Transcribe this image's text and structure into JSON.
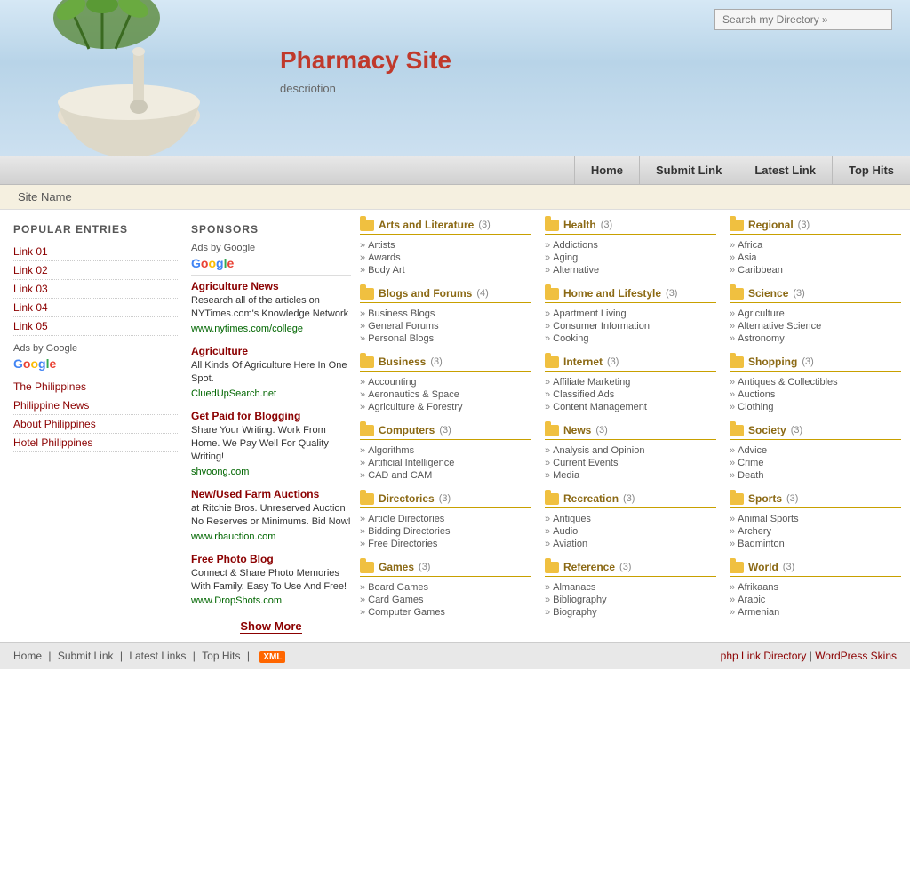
{
  "header": {
    "search_placeholder": "Search my Directory »",
    "site_title": "Pharmacy Site",
    "site_desc": "descriotion"
  },
  "navbar": {
    "items": [
      {
        "label": "Home",
        "href": "#"
      },
      {
        "label": "Submit Link",
        "href": "#"
      },
      {
        "label": "Latest Link",
        "href": "#"
      },
      {
        "label": "Top Hits",
        "href": "#"
      }
    ]
  },
  "sitename": "Site Name",
  "sidebar": {
    "popular_title": "POPULAR ENTRIES",
    "popular_links": [
      {
        "label": "Link 01",
        "href": "#"
      },
      {
        "label": "Link 02",
        "href": "#"
      },
      {
        "label": "Link 03",
        "href": "#"
      },
      {
        "label": "Link 04",
        "href": "#"
      },
      {
        "label": "Link 05",
        "href": "#"
      }
    ],
    "ads_label": "Ads by Google",
    "geo_links": [
      {
        "label": "The Philippines",
        "href": "#"
      },
      {
        "label": "Philippine News",
        "href": "#"
      },
      {
        "label": "About Philippines",
        "href": "#"
      },
      {
        "label": "Hotel Philippines",
        "href": "#"
      }
    ]
  },
  "sponsors": {
    "title": "SPONSORS",
    "ads_label": "Ads by Google",
    "show_more": "Show More",
    "items": [
      {
        "title": "Agriculture News",
        "desc": "Research all of the articles on NYTimes.com's Knowledge Network",
        "url": "www.nytimes.com/college"
      },
      {
        "title": "Agriculture",
        "desc": "All Kinds Of Agriculture Here In One Spot.",
        "url": "CluedUpSearch.net"
      },
      {
        "title": "Get Paid for Blogging",
        "desc": "Share Your Writing. Work From Home. We Pay Well For Quality Writing!",
        "url": "shvoong.com"
      },
      {
        "title": "New/Used Farm Auctions",
        "desc": "at Ritchie Bros. Unreserved Auction No Reserves or Minimums. Bid Now!",
        "url": "www.rbauction.com"
      },
      {
        "title": "Free Photo Blog",
        "desc": "Connect & Share Photo Memories With Family. Easy To Use And Free!",
        "url": "www.DropShots.com"
      }
    ]
  },
  "directory": {
    "columns": [
      [
        {
          "title": "Arts and Literature",
          "count": "(3)",
          "items": [
            "Artists",
            "Awards",
            "Body Art"
          ]
        },
        {
          "title": "Blogs and Forums",
          "count": "(4)",
          "items": [
            "Business Blogs",
            "General Forums",
            "Personal Blogs"
          ]
        },
        {
          "title": "Business",
          "count": "(3)",
          "items": [
            "Accounting",
            "Aeronautics & Space",
            "Agriculture & Forestry"
          ]
        },
        {
          "title": "Computers",
          "count": "(3)",
          "items": [
            "Algorithms",
            "Artificial Intelligence",
            "CAD and CAM"
          ]
        },
        {
          "title": "Directories",
          "count": "(3)",
          "items": [
            "Article Directories",
            "Bidding Directories",
            "Free Directories"
          ]
        },
        {
          "title": "Games",
          "count": "(3)",
          "items": [
            "Board Games",
            "Card Games",
            "Computer Games"
          ]
        }
      ],
      [
        {
          "title": "Health",
          "count": "(3)",
          "items": [
            "Addictions",
            "Aging",
            "Alternative"
          ]
        },
        {
          "title": "Home and Lifestyle",
          "count": "(3)",
          "items": [
            "Apartment Living",
            "Consumer Information",
            "Cooking"
          ]
        },
        {
          "title": "Internet",
          "count": "(3)",
          "items": [
            "Affiliate Marketing",
            "Classified Ads",
            "Content Management"
          ]
        },
        {
          "title": "News",
          "count": "(3)",
          "items": [
            "Analysis and Opinion",
            "Current Events",
            "Media"
          ]
        },
        {
          "title": "Recreation",
          "count": "(3)",
          "items": [
            "Antiques",
            "Audio",
            "Aviation"
          ]
        },
        {
          "title": "Reference",
          "count": "(3)",
          "items": [
            "Almanacs",
            "Bibliography",
            "Biography"
          ]
        }
      ],
      [
        {
          "title": "Regional",
          "count": "(3)",
          "items": [
            "Africa",
            "Asia",
            "Caribbean"
          ]
        },
        {
          "title": "Science",
          "count": "(3)",
          "items": [
            "Agriculture",
            "Alternative Science",
            "Astronomy"
          ]
        },
        {
          "title": "Shopping",
          "count": "(3)",
          "items": [
            "Antiques & Collectibles",
            "Auctions",
            "Clothing"
          ]
        },
        {
          "title": "Society",
          "count": "(3)",
          "items": [
            "Advice",
            "Crime",
            "Death"
          ]
        },
        {
          "title": "Sports",
          "count": "(3)",
          "items": [
            "Animal Sports",
            "Archery",
            "Badminton"
          ]
        },
        {
          "title": "World",
          "count": "(3)",
          "items": [
            "Afrikaans",
            "Arabic",
            "Armenian"
          ]
        }
      ]
    ]
  },
  "footer": {
    "left_links": [
      "Home",
      "Submit Link",
      "Latest Links",
      "Top Hits"
    ],
    "xml_label": "XML",
    "right_links": [
      "php Link Directory",
      "WordPress Skins"
    ]
  }
}
